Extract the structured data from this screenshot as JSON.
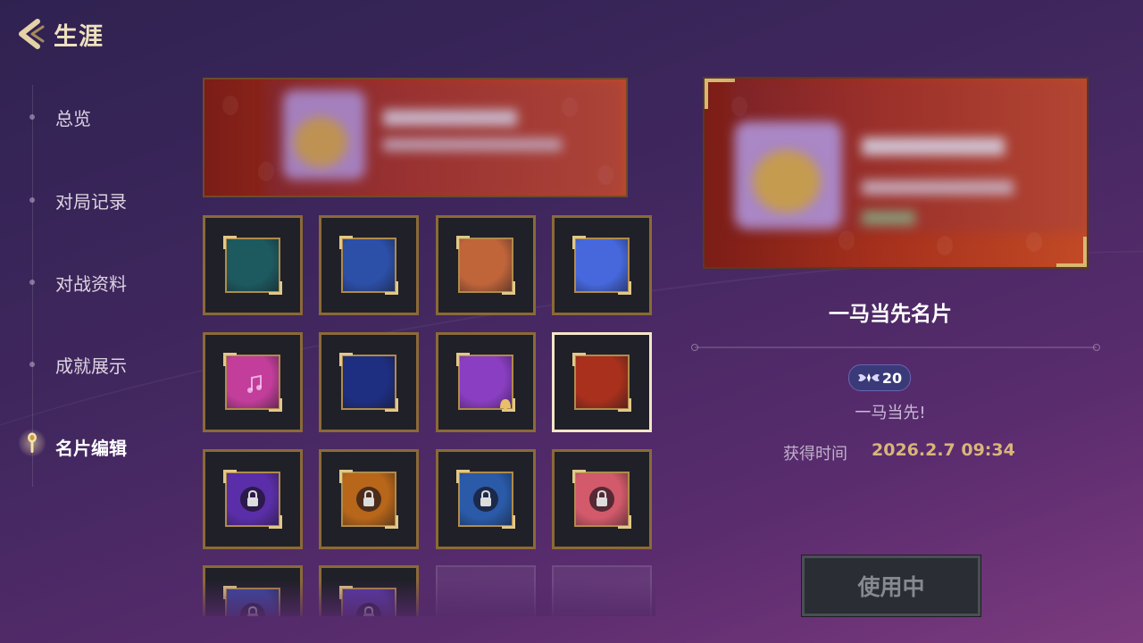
{
  "header": {
    "title": "生涯",
    "back_icon": "chevron-left-icon"
  },
  "sidebar": {
    "items": [
      {
        "label": "总览",
        "active": false
      },
      {
        "label": "对局记录",
        "active": false
      },
      {
        "label": "对战资料",
        "active": false
      },
      {
        "label": "成就展示",
        "active": false
      },
      {
        "label": "名片编辑",
        "active": true,
        "icon": "spoon-icon"
      }
    ]
  },
  "grid": {
    "cards": [
      {
        "color": "#1d5a60",
        "locked": false,
        "selected": false
      },
      {
        "color": "#2c4fa8",
        "locked": false,
        "selected": false
      },
      {
        "color": "#c0653a",
        "locked": false,
        "selected": false
      },
      {
        "color": "#4668dc",
        "locked": false,
        "selected": false
      },
      {
        "color": "#c23e9a",
        "locked": false,
        "selected": false
      },
      {
        "color": "#1e2f82",
        "locked": false,
        "selected": false
      },
      {
        "color": "#8a3ec2",
        "locked": false,
        "selected": false
      },
      {
        "color": "#a8301c",
        "locked": false,
        "selected": true
      },
      {
        "color": "#5a2ea8",
        "locked": true,
        "selected": false
      },
      {
        "color": "#b8661a",
        "locked": true,
        "selected": false
      },
      {
        "color": "#2a5aa8",
        "locked": true,
        "selected": false
      },
      {
        "color": "#d25a6a",
        "locked": true,
        "selected": false
      },
      {
        "color": "#3a4aa2",
        "locked": true,
        "selected": false
      },
      {
        "color": "#5a3aa8",
        "locked": true,
        "selected": false
      },
      {
        "color": "",
        "locked": false,
        "selected": false,
        "empty": true
      },
      {
        "color": "",
        "locked": false,
        "selected": false,
        "empty": true
      }
    ]
  },
  "detail": {
    "card_name": "一马当先名片",
    "badge_value": "20",
    "subtitle": "一马当先!",
    "obtained_label": "获得时间",
    "obtained_time": "2026.2.7  09:34",
    "use_button": "使用中"
  },
  "colors": {
    "frame_gold": "#8b6a36",
    "banner_red": "#a5301c",
    "accent_text": "#d9b57a"
  }
}
